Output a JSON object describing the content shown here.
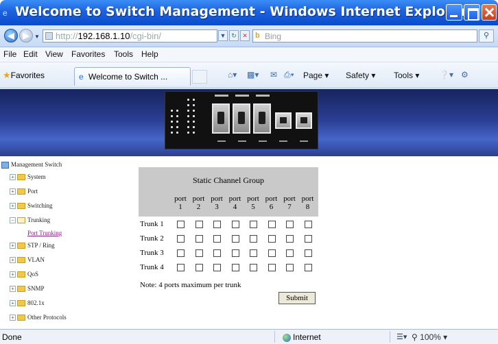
{
  "window": {
    "title": "Welcome to Switch Management - Windows Internet Explorer"
  },
  "address": {
    "url_prefix": "http://",
    "host": "192.168.1.10",
    "path": "/cgi-bin/"
  },
  "search": {
    "placeholder": "Bing"
  },
  "menu": [
    "File",
    "Edit",
    "View",
    "Favorites",
    "Tools",
    "Help"
  ],
  "favorites_bar": {
    "favorites_label": "Favorites",
    "tab_title": "Welcome to Switch ...",
    "commands": [
      "Page",
      "Safety",
      "Tools"
    ]
  },
  "tree": {
    "root": "Management Switch",
    "items": [
      "System",
      "Port",
      "Switching",
      "Trunking",
      "STP / Ring",
      "VLAN",
      "QoS",
      "SNMP",
      "802.1x",
      "Other Protocols"
    ],
    "expanded": "Trunking",
    "sub_link": "Port Trunking"
  },
  "form": {
    "title": "Static Channel Group",
    "port_word": "port",
    "ports": [
      "1",
      "2",
      "3",
      "4",
      "5",
      "6",
      "7",
      "8"
    ],
    "trunks": [
      "Trunk 1",
      "Trunk 2",
      "Trunk 3",
      "Trunk 4"
    ],
    "checked": [
      [
        false,
        false,
        false,
        false,
        false,
        false,
        false,
        false
      ],
      [
        false,
        false,
        false,
        false,
        false,
        false,
        false,
        false
      ],
      [
        false,
        false,
        false,
        false,
        false,
        false,
        false,
        false
      ],
      [
        false,
        false,
        false,
        false,
        false,
        false,
        false,
        false
      ]
    ],
    "note": "Note: 4 ports maximum per trunk",
    "submit": "Submit"
  },
  "status": {
    "text": "Done",
    "zone": "Internet",
    "zoom": "100%"
  },
  "colors": {
    "title_bar": "#1c62e0",
    "banner": "#2a3d92",
    "form_header": "#c9c9c9",
    "visited_link": "#8b1f8a"
  }
}
